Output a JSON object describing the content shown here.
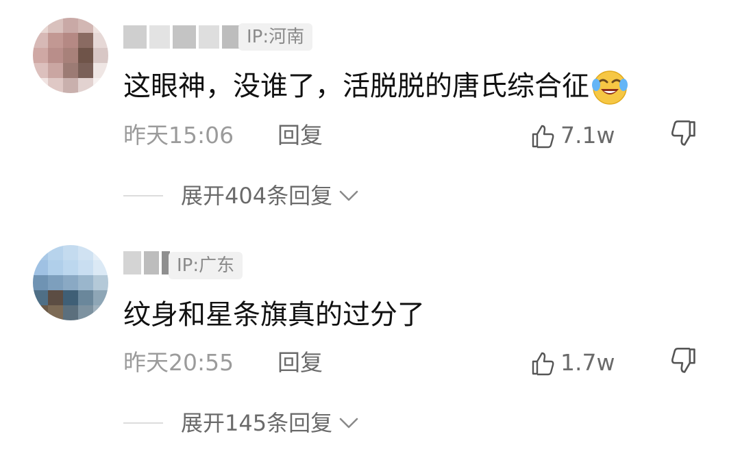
{
  "comments": [
    {
      "ip_label": "IP:河南",
      "text": "这眼神，没谁了，活脱脱的唐氏综合征",
      "emoji": "crying-laughing-face",
      "time": "昨天15:06",
      "reply_label": "回复",
      "likes": "7.1w",
      "expand_label": "展开404条回复"
    },
    {
      "ip_label": "IP:广东",
      "text": "纹身和星条旗真的过分了",
      "time": "昨天20:55",
      "reply_label": "回复",
      "likes": "1.7w",
      "expand_label": "展开145条回复"
    }
  ],
  "icons": {
    "like": "thumbs-up-icon",
    "dislike": "thumbs-down-icon",
    "expand": "chevron-down-icon"
  },
  "colors": {
    "text_primary": "#111111",
    "text_secondary": "#9b9b9b",
    "badge_bg": "#f1f1f1"
  }
}
